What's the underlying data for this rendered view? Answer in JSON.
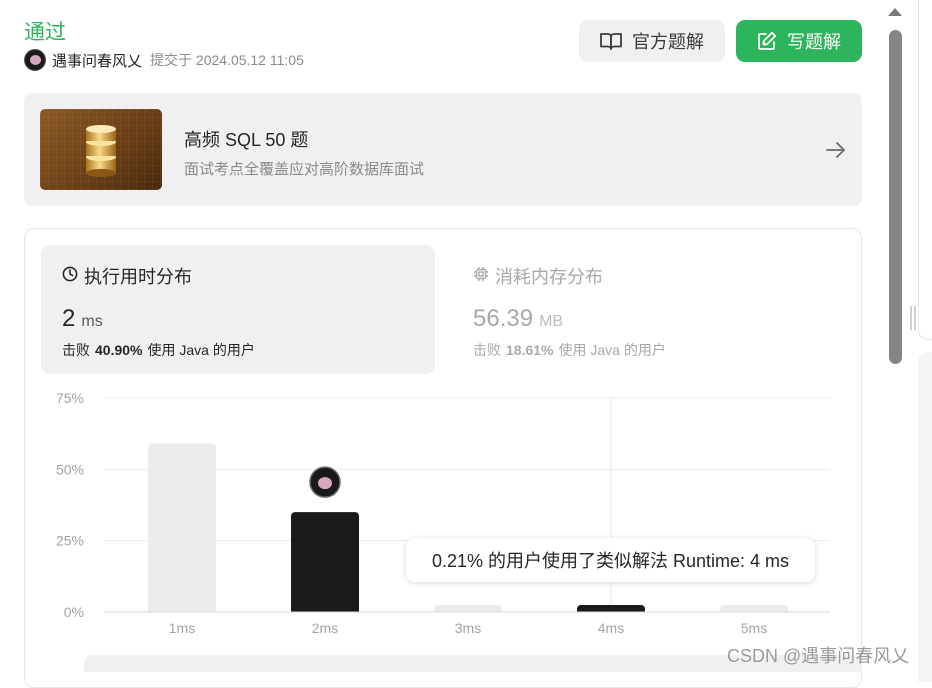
{
  "header": {
    "status": "通过",
    "username": "遇事问春风乂",
    "submitted_text": "提交于 2024.05.12 11:05",
    "official_solution_label": "官方题解",
    "write_solution_label": "写题解"
  },
  "banner": {
    "title": "高频 SQL 50 题",
    "subtitle": "面试考点全覆盖应对高阶数据库面试"
  },
  "runtime": {
    "title": "执行用时分布",
    "value": "2",
    "unit": "ms",
    "beat_prefix": "击败",
    "beat_percent": "40.90%",
    "beat_suffix": "使用 Java 的用户"
  },
  "memory": {
    "title": "消耗内存分布",
    "value": "56.39",
    "unit": "MB",
    "beat_prefix": "击败",
    "beat_percent": "18.61%",
    "beat_suffix": "使用 Java 的用户"
  },
  "tooltip": "0.21% 的用户使用了类似解法 Runtime: 4 ms",
  "watermark": "CSDN @遇事问春风乂",
  "colors": {
    "accent_green": "#2db55d",
    "bar_highlight": "#1a1a1a",
    "bar_default": "#ebebeb"
  },
  "chart_data": {
    "type": "bar",
    "categories": [
      "1ms",
      "2ms",
      "3ms",
      "4ms",
      "5ms"
    ],
    "values": [
      59,
      35,
      1,
      0.21,
      1
    ],
    "highlighted": [
      "2ms",
      "4ms"
    ],
    "user_marker": "2ms",
    "ytick_labels": [
      "0%",
      "25%",
      "50%",
      "75%"
    ],
    "yticks": [
      0,
      25,
      50,
      75
    ],
    "ylim": [
      0,
      75
    ],
    "grid": true
  }
}
